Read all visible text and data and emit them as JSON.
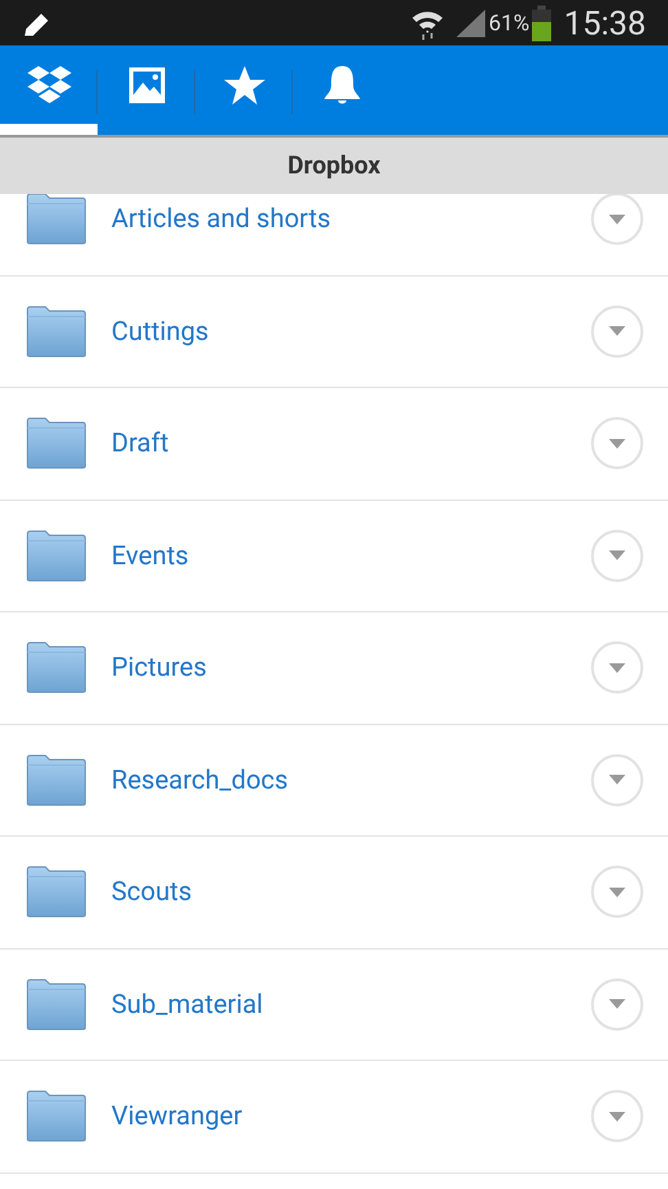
{
  "status_bar": {
    "battery_percent": "61%",
    "time": "15:38"
  },
  "tabs": [
    {
      "kind": "dropbox",
      "selected": true
    },
    {
      "kind": "photos",
      "selected": false
    },
    {
      "kind": "favorites",
      "selected": false
    },
    {
      "kind": "notifications",
      "selected": false
    }
  ],
  "header": {
    "title": "Dropbox"
  },
  "folders": [
    {
      "name": "Articles and shorts"
    },
    {
      "name": "Cuttings"
    },
    {
      "name": "Draft"
    },
    {
      "name": "Events"
    },
    {
      "name": "Pictures"
    },
    {
      "name": "Research_docs"
    },
    {
      "name": "Scouts"
    },
    {
      "name": "Sub_material"
    },
    {
      "name": "Viewranger"
    }
  ]
}
